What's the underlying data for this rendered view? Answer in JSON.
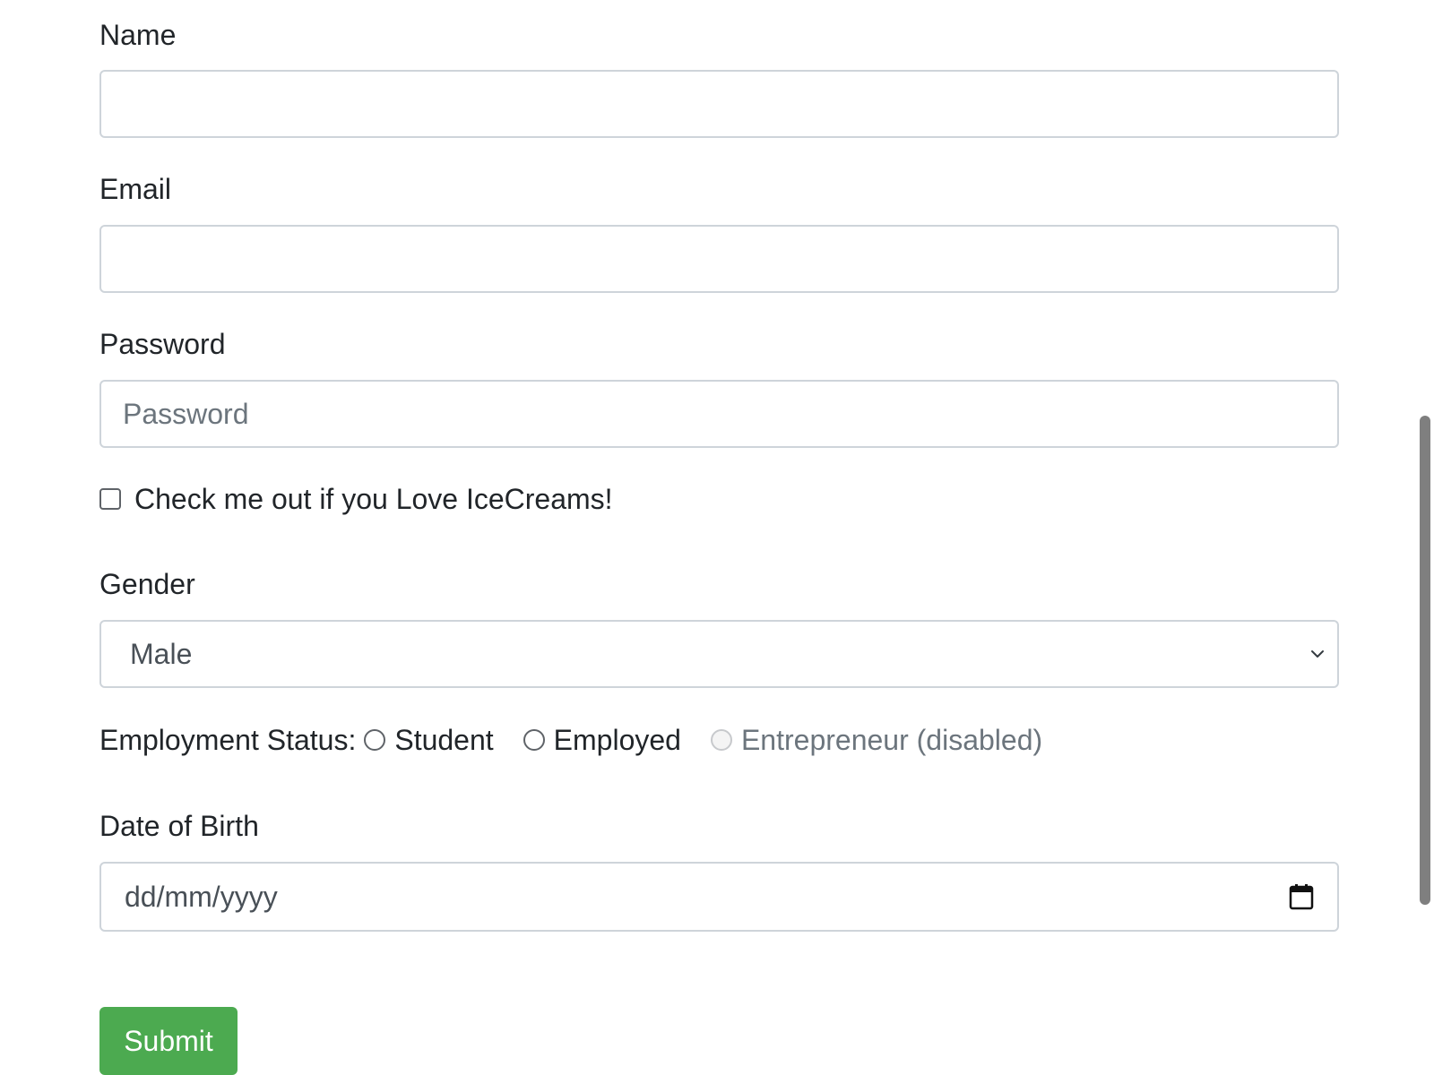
{
  "form": {
    "name": {
      "label": "Name",
      "value": "",
      "placeholder": ""
    },
    "email": {
      "label": "Email",
      "value": "",
      "placeholder": ""
    },
    "password": {
      "label": "Password",
      "value": "",
      "placeholder": "Password"
    },
    "icecream_checkbox": {
      "label": "Check me out if you Love IceCreams!",
      "checked": false
    },
    "gender": {
      "label": "Gender",
      "selected": "Male",
      "icon": "chevron-down-icon"
    },
    "employment_status": {
      "label": "Employment Status:",
      "options": [
        {
          "label": "Student",
          "checked": false,
          "disabled": false
        },
        {
          "label": "Employed",
          "checked": false,
          "disabled": false
        },
        {
          "label": "Entrepreneur (disabled)",
          "checked": false,
          "disabled": true
        }
      ]
    },
    "date_of_birth": {
      "label": "Date of Birth",
      "placeholder": "dd/mm/yyyy",
      "icon": "calendar-icon"
    },
    "submit_label": "Submit"
  },
  "colors": {
    "submit_bg": "#4caa50",
    "border": "#ced4da",
    "text": "#212529",
    "muted": "#6c757d"
  }
}
